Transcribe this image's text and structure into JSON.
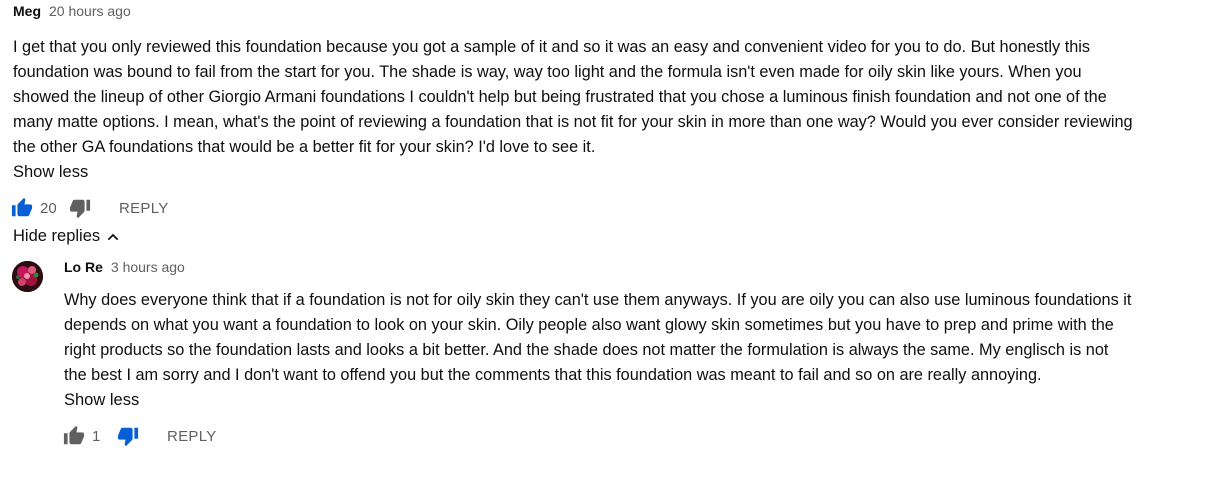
{
  "comments": [
    {
      "author": "Meg",
      "time": "20 hours ago",
      "text": "I get that you only reviewed this foundation because you got a sample of it and so it was an easy and convenient video for you to do.  But honestly this foundation was bound to fail from the start for you.  The shade is way, way too light and the formula isn't even made for oily skin like yours.  When you showed the lineup of other Giorgio Armani foundations I couldn't help but being frustrated that you chose a luminous finish foundation and not one of the many matte options.  I mean, what's the point of reviewing a foundation that is not fit for your skin in more than one way?  Would you ever consider reviewing the other GA foundations that would be a better fit for your skin?  I'd love to see it.",
      "show_less": "Show less",
      "likes": "20",
      "reply": "REPLY",
      "liked": true,
      "disliked": false
    }
  ],
  "hide_replies": "Hide replies",
  "replies": [
    {
      "author": "Lo Re",
      "time": "3 hours ago",
      "text": "Why does everyone think that if a foundation is not for oily skin they can't use them anyways. If you are oily you can also use luminous foundations it depends on what you want a foundation to look on your skin. Oily people also want glowy skin sometimes but you have to prep and prime with the right products so the foundation lasts and looks a bit better. And the shade does not matter the formulation is always the same. My englisch is not the best I am sorry and I don't want to offend you but the comments that this foundation was meant to fail and so on are really annoying.",
      "show_less": "Show less",
      "likes": "1",
      "reply": "REPLY",
      "liked": false,
      "disliked": true
    }
  ],
  "icons": {
    "like": "thumb-up-icon",
    "dislike": "thumb-down-icon",
    "chevron": "chevron-up-icon"
  },
  "colors": {
    "active": "#065fd4",
    "inactive": "#606060"
  }
}
